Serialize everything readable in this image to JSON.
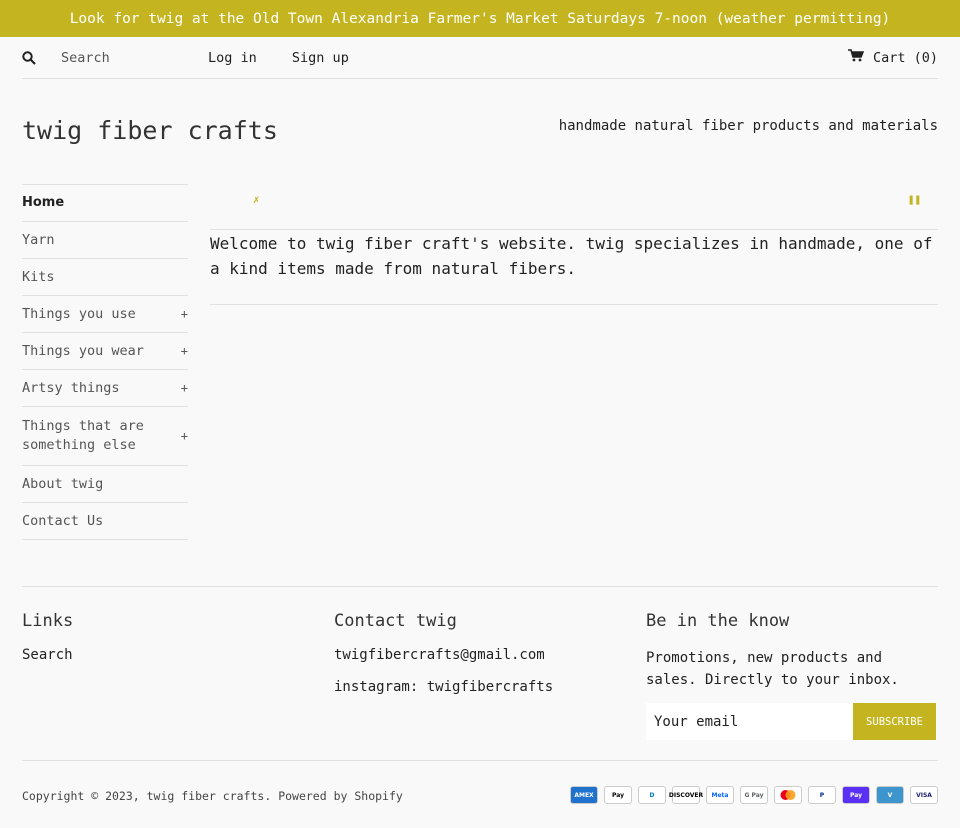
{
  "announcement": "Look for twig at the Old Town Alexandria Farmer's Market Saturdays 7-noon (weather permitting)",
  "header": {
    "search_placeholder": "Search",
    "login_label": "Log in",
    "signup_label": "Sign up",
    "cart_label": "Cart (0)",
    "search_icon": "search-icon",
    "cart_icon": "cart-icon"
  },
  "site": {
    "title": "twig fiber crafts",
    "tagline": "handmade natural fiber products and materials"
  },
  "nav": {
    "items": [
      {
        "label": "Home"
      },
      {
        "label": "Yarn"
      },
      {
        "label": "Kits"
      },
      {
        "label": "Things you use",
        "expand": "+"
      },
      {
        "label": "Things you wear",
        "expand": "+"
      },
      {
        "label": "Artsy things",
        "expand": "+"
      },
      {
        "label": "Things that are something else",
        "expand": "+"
      },
      {
        "label": "About twig"
      },
      {
        "label": "Contact Us"
      }
    ]
  },
  "main": {
    "welcome": "Welcome to twig fiber craft's website. twig specializes in handmade, one of a kind items made from natural fibers."
  },
  "footer": {
    "links_title": "Links",
    "links": [
      "Search"
    ],
    "contact_title": "Contact twig",
    "contact_email": "twigfibercrafts@gmail.com",
    "contact_instagram": "instagram: twigfibercrafts",
    "newsletter_title": "Be in the know",
    "newsletter_text": "Promotions, new products and sales. Directly to your inbox.",
    "email_placeholder": "Your email",
    "subscribe_label": "SUBSCRIBE",
    "copyright": "Copyright © 2023, twig fiber crafts.",
    "powered_by": "Powered by Shopify",
    "payment_methods": [
      {
        "name": "american-express-icon",
        "label": "AMEX",
        "bg": "#1f72cd",
        "fg": "#ffffff"
      },
      {
        "name": "apple-pay-icon",
        "label": "Pay",
        "bg": "#ffffff",
        "fg": "#000000"
      },
      {
        "name": "diners-club-icon",
        "label": "D",
        "bg": "#ffffff",
        "fg": "#0079be"
      },
      {
        "name": "discover-icon",
        "label": "DISCOVER",
        "bg": "#ffffff",
        "fg": "#000000"
      },
      {
        "name": "meta-pay-icon",
        "label": "Meta",
        "bg": "#ffffff",
        "fg": "#0866ff"
      },
      {
        "name": "google-pay-icon",
        "label": "G Pay",
        "bg": "#ffffff",
        "fg": "#5f6368"
      },
      {
        "name": "mastercard-icon",
        "label": "",
        "bg": "#ffffff",
        "fg": "#eb001b"
      },
      {
        "name": "paypal-icon",
        "label": "P",
        "bg": "#ffffff",
        "fg": "#003087"
      },
      {
        "name": "shop-pay-icon",
        "label": "Pay",
        "bg": "#5a31f4",
        "fg": "#ffffff"
      },
      {
        "name": "venmo-icon",
        "label": "V",
        "bg": "#3d95ce",
        "fg": "#ffffff"
      },
      {
        "name": "visa-icon",
        "label": "VISA",
        "bg": "#ffffff",
        "fg": "#1a1f71"
      }
    ]
  },
  "colors": {
    "accent": "#c4b520",
    "background": "#f9f9f9"
  }
}
